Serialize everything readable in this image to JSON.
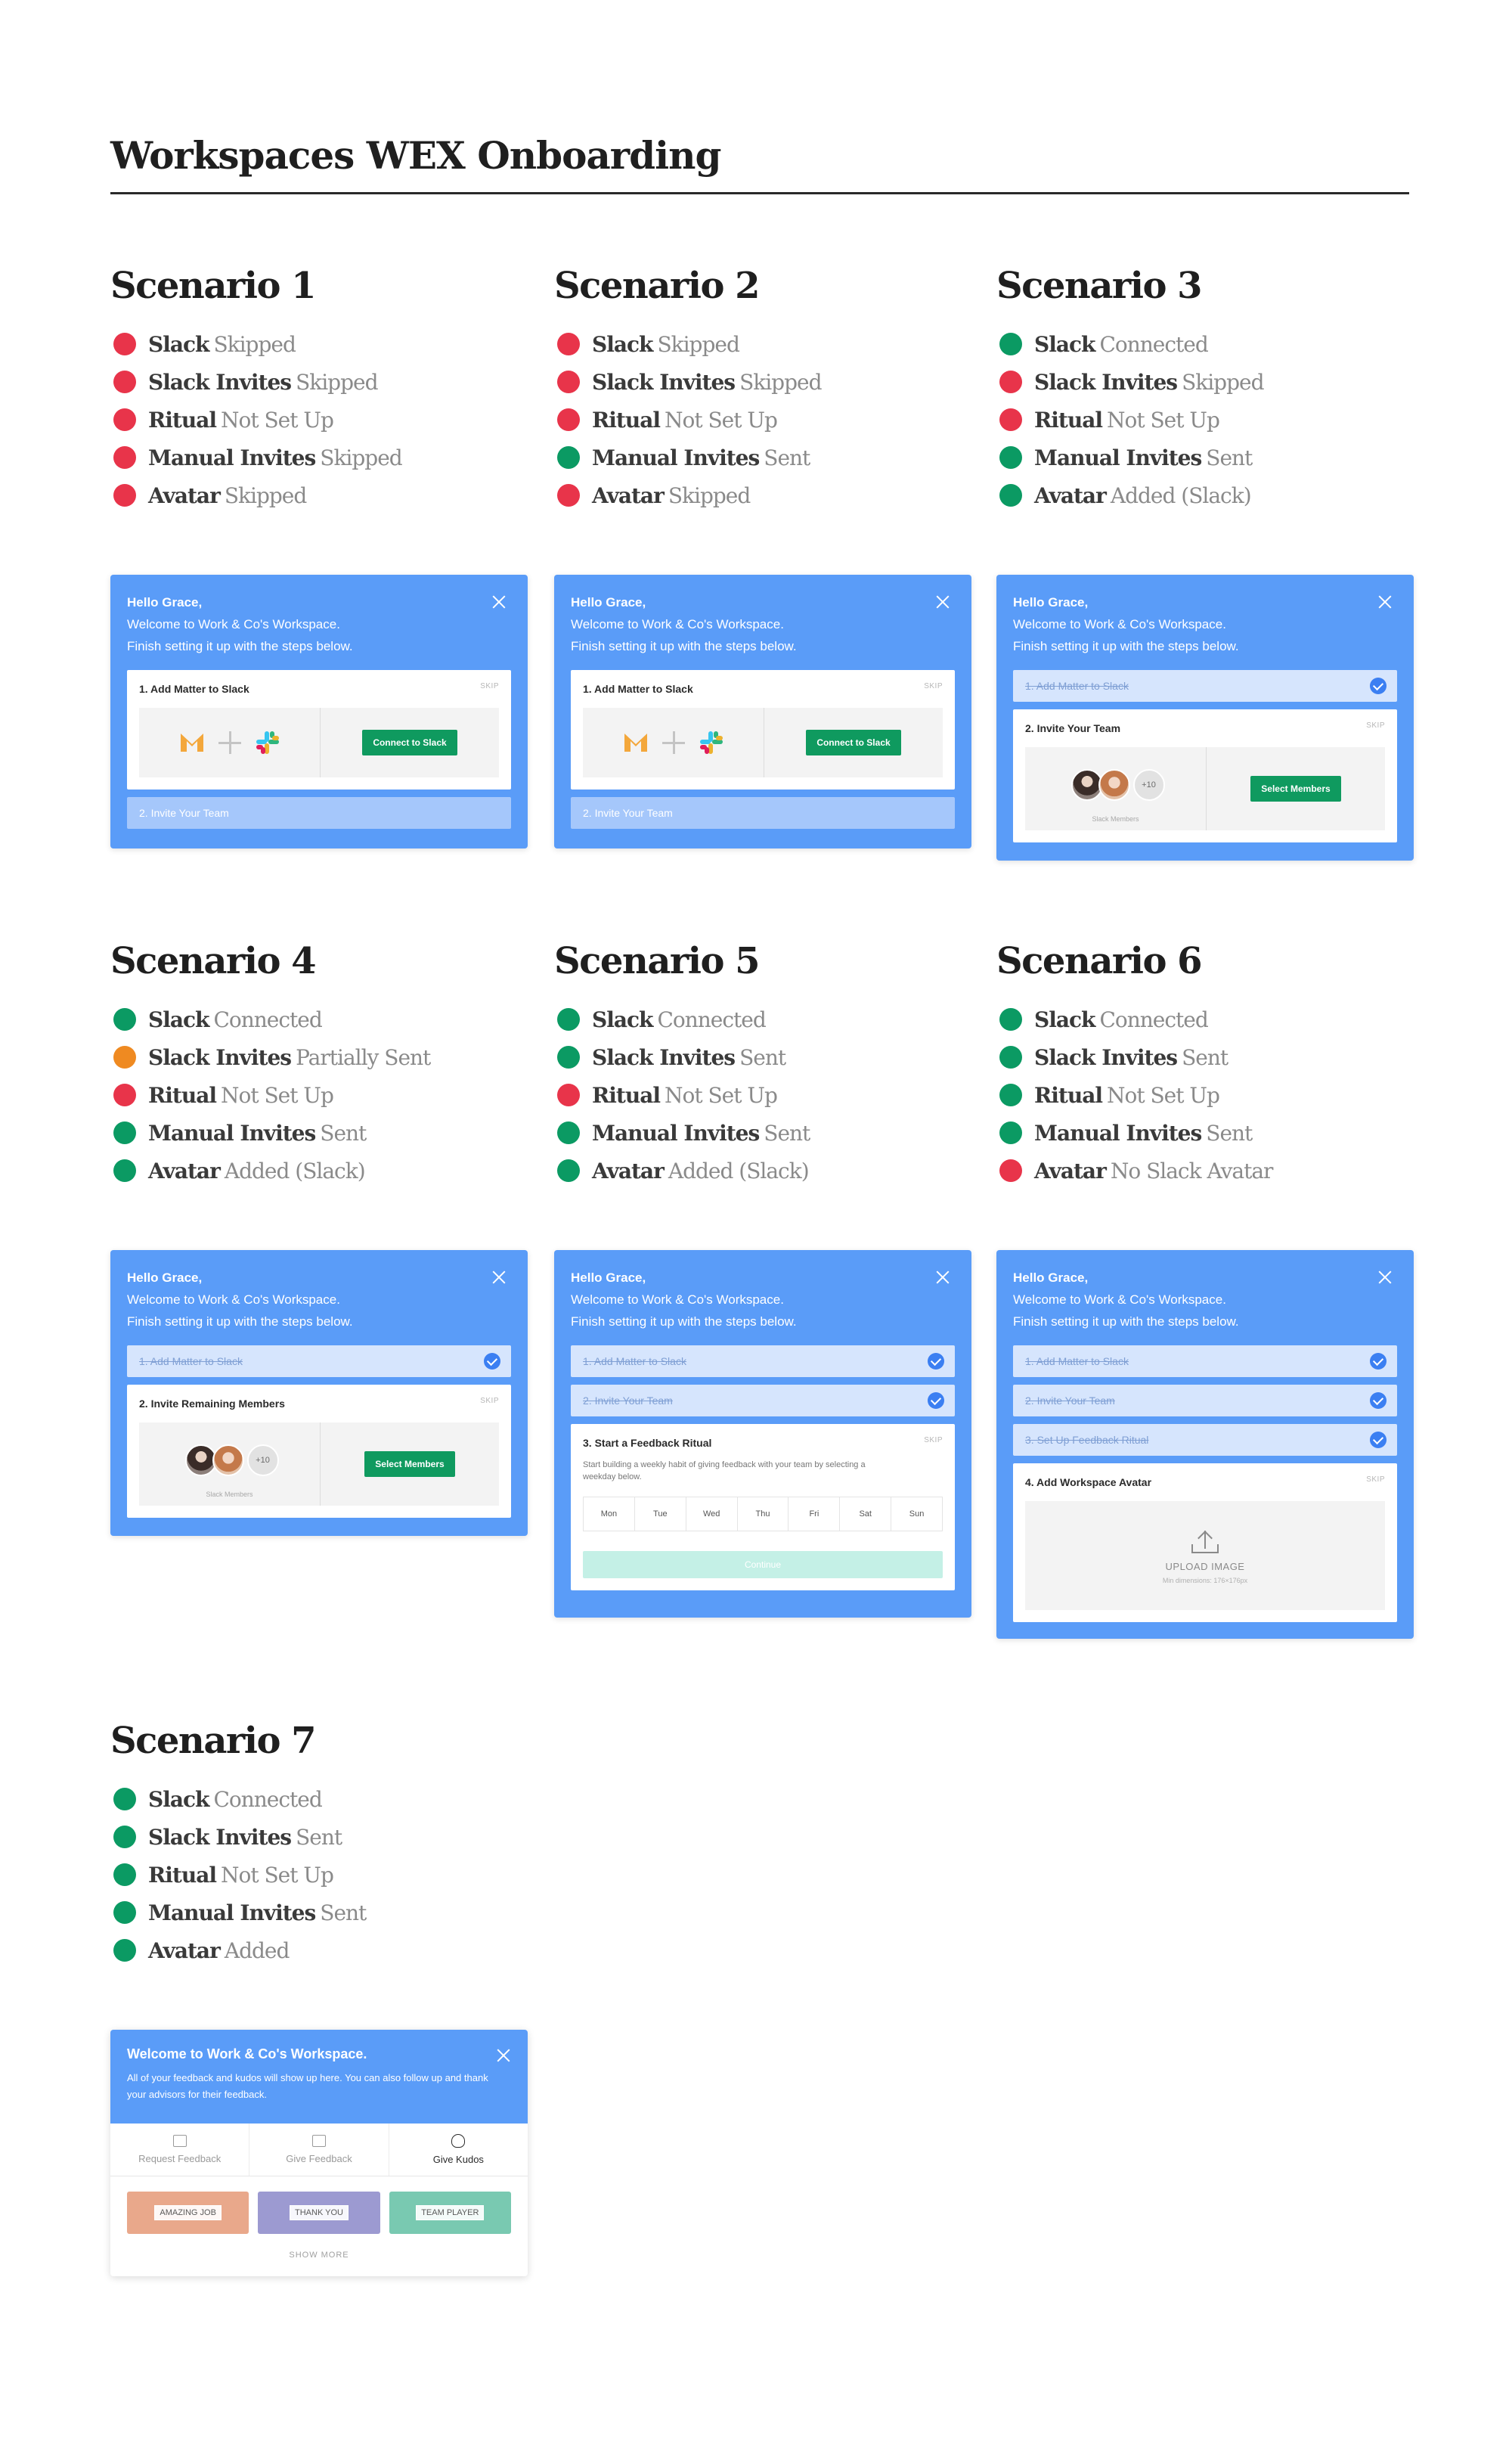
{
  "page": {
    "title": "Workspaces WEX Onboarding"
  },
  "colors": {
    "red": "#e8344a",
    "green": "#0b9a63",
    "orange": "#ef8a21",
    "card_blue": "#5a9cf8"
  },
  "card_text": {
    "greeting": "Hello Grace,",
    "welcome": "Welcome to Work & Co's Workspace.",
    "finish": "Finish setting it up with the steps below.",
    "skip": "SKIP",
    "step1": "1. Add Matter to Slack",
    "step1_done": "1. Add Matter to Slack",
    "step2_pending": "2. Invite Your Team",
    "step2_invite": "2. Invite Your Team",
    "step2_remaining": "2. Invite Remaining Members",
    "step2_done": "2. Invite Your Team",
    "step3_open": "3. Start a Feedback Ritual",
    "step3_done": "3. Set Up Feedback Ritual",
    "step4_open": "4. Add Workspace Avatar",
    "connect_btn": "Connect to Slack",
    "select_btn": "Select Members",
    "more_count": "+10",
    "slack_members": "Slack Members",
    "ritual_text": "Start building a weekly habit of giving feedback with your team by selecting a weekday below.",
    "days": [
      "Mon",
      "Tue",
      "Wed",
      "Thu",
      "Fri",
      "Sat",
      "Sun"
    ],
    "continue": "Continue",
    "upload_title": "UPLOAD IMAGE",
    "upload_hint": "Min dimensions: 176×176px"
  },
  "scenarios": [
    {
      "title": "Scenario 1",
      "items": [
        {
          "label": "Slack",
          "status": "Skipped",
          "color": "red"
        },
        {
          "label": "Slack Invites",
          "status": "Skipped",
          "color": "red"
        },
        {
          "label": "Ritual",
          "status": "Not Set Up",
          "color": "red"
        },
        {
          "label": "Manual Invites",
          "status": "Skipped",
          "color": "red"
        },
        {
          "label": "Avatar",
          "status": "Skipped",
          "color": "red"
        }
      ]
    },
    {
      "title": "Scenario 2",
      "items": [
        {
          "label": "Slack",
          "status": "Skipped",
          "color": "red"
        },
        {
          "label": "Slack Invites",
          "status": "Skipped",
          "color": "red"
        },
        {
          "label": "Ritual",
          "status": "Not Set Up",
          "color": "red"
        },
        {
          "label": "Manual Invites",
          "status": "Sent",
          "color": "green"
        },
        {
          "label": "Avatar",
          "status": "Skipped",
          "color": "red"
        }
      ]
    },
    {
      "title": "Scenario 3",
      "items": [
        {
          "label": "Slack",
          "status": "Connected",
          "color": "green"
        },
        {
          "label": "Slack Invites",
          "status": "Skipped",
          "color": "red"
        },
        {
          "label": "Ritual",
          "status": "Not Set Up",
          "color": "red"
        },
        {
          "label": "Manual Invites",
          "status": "Sent",
          "color": "green"
        },
        {
          "label": "Avatar",
          "status": "Added (Slack)",
          "color": "green"
        }
      ]
    },
    {
      "title": "Scenario 4",
      "items": [
        {
          "label": "Slack",
          "status": "Connected",
          "color": "green"
        },
        {
          "label": "Slack Invites",
          "status": "Partially Sent",
          "color": "orange"
        },
        {
          "label": "Ritual",
          "status": "Not Set Up",
          "color": "red"
        },
        {
          "label": "Manual Invites",
          "status": "Sent",
          "color": "green"
        },
        {
          "label": "Avatar",
          "status": "Added (Slack)",
          "color": "green"
        }
      ]
    },
    {
      "title": "Scenario 5",
      "items": [
        {
          "label": "Slack",
          "status": "Connected",
          "color": "green"
        },
        {
          "label": "Slack Invites",
          "status": "Sent",
          "color": "green"
        },
        {
          "label": "Ritual",
          "status": "Not Set Up",
          "color": "red"
        },
        {
          "label": "Manual Invites",
          "status": "Sent",
          "color": "green"
        },
        {
          "label": "Avatar",
          "status": "Added (Slack)",
          "color": "green"
        }
      ]
    },
    {
      "title": "Scenario 6",
      "items": [
        {
          "label": "Slack",
          "status": "Connected",
          "color": "green"
        },
        {
          "label": "Slack Invites",
          "status": "Sent",
          "color": "green"
        },
        {
          "label": "Ritual",
          "status": "Not Set Up",
          "color": "green"
        },
        {
          "label": "Manual Invites",
          "status": "Sent",
          "color": "green"
        },
        {
          "label": "Avatar",
          "status": "No Slack Avatar",
          "color": "red"
        }
      ]
    },
    {
      "title": "Scenario 7",
      "items": [
        {
          "label": "Slack",
          "status": "Connected",
          "color": "green"
        },
        {
          "label": "Slack Invites",
          "status": "Sent",
          "color": "green"
        },
        {
          "label": "Ritual",
          "status": "Not Set Up",
          "color": "green"
        },
        {
          "label": "Manual Invites",
          "status": "Sent",
          "color": "green"
        },
        {
          "label": "Avatar",
          "status": "Added",
          "color": "green"
        }
      ]
    }
  ],
  "kudos": {
    "title": "Welcome to Work & Co's Workspace.",
    "subtitle": "All of your feedback and kudos will show up here. You can also follow up and thank your advisors for their feedback.",
    "tabs": [
      "Request Feedback",
      "Give Feedback",
      "Give Kudos"
    ],
    "cards": [
      "AMAZING JOB",
      "THANK YOU",
      "TEAM PLAYER"
    ],
    "show_more": "SHOW MORE"
  }
}
